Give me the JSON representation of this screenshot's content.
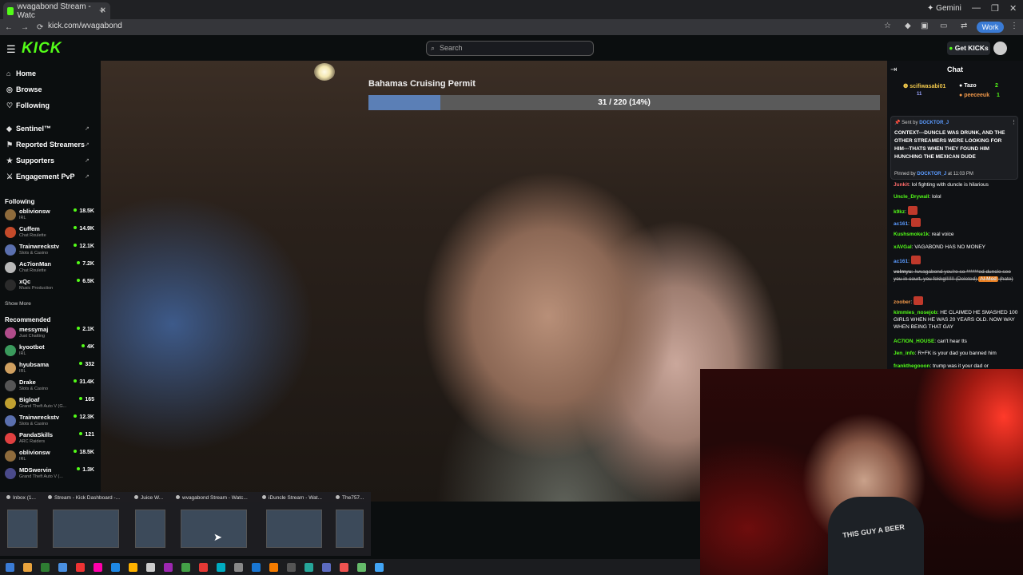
{
  "browser": {
    "tab_title": "wvagabond Stream - Watc",
    "new_tab": "+",
    "gemini": "Gemini",
    "url": "kick.com/wvagabond",
    "profile": "Work",
    "window_controls": [
      "—",
      "❐",
      "✕"
    ]
  },
  "kick": {
    "logo": "KICK",
    "search_placeholder": "Search",
    "get_kicks": "Get KICKs"
  },
  "sidebar": {
    "nav": [
      "Home",
      "Browse",
      "Following"
    ],
    "extras": [
      "Sentinel™",
      "Reported Streamers",
      "Supporters",
      "Engagement PvP"
    ],
    "following_title": "Following",
    "following": [
      {
        "name": "oblivionsw",
        "category": "IRL",
        "viewers": "18.5K",
        "color": "#8e6b3c"
      },
      {
        "name": "Cuffem",
        "category": "Chat Roulette",
        "viewers": "14.9K",
        "color": "#c44a2a"
      },
      {
        "name": "Trainwreckstv",
        "category": "Slots & Casino",
        "viewers": "12.1K",
        "color": "#5a6fae"
      },
      {
        "name": "Ac7ionMan",
        "category": "Chat Roulette",
        "viewers": "7.2K",
        "color": "#b8b8b8"
      },
      {
        "name": "xQc",
        "category": "Music Production",
        "viewers": "6.5K",
        "color": "#2b2b2b"
      }
    ],
    "show_more": "Show More",
    "recommended_title": "Recommended",
    "recommended": [
      {
        "name": "messymaj",
        "category": "Just Chatting",
        "viewers": "2.1K",
        "color": "#b04c8a"
      },
      {
        "name": "kyootbot",
        "category": "IRL",
        "viewers": "4K",
        "color": "#3a9a5c"
      },
      {
        "name": "hyubsama",
        "category": "IRL",
        "viewers": "332",
        "color": "#d0a060"
      },
      {
        "name": "Drake",
        "category": "Slots & Casino",
        "viewers": "31.4K",
        "color": "#555"
      },
      {
        "name": "Bigloaf",
        "category": "Grand Theft Auto V (G...",
        "viewers": "165",
        "color": "#c0a030"
      },
      {
        "name": "Trainwreckstv",
        "category": "Slots & Casino",
        "viewers": "12.3K",
        "color": "#5a6fae"
      },
      {
        "name": "PandaSkills",
        "category": "ARC Raiders",
        "viewers": "121",
        "color": "#e04040"
      },
      {
        "name": "oblivionsw",
        "category": "IRL",
        "viewers": "18.5K",
        "color": "#8e6b3c"
      },
      {
        "name": "MDSwervin",
        "category": "Grand Theft Auto V (...",
        "viewers": "1.3K",
        "color": "#4a4a8a"
      }
    ]
  },
  "stream": {
    "goal_title": "Bahamas Cruising Permit",
    "goal_text": "31 / 220 (14%)",
    "goal_fraction": 0.14
  },
  "chat": {
    "title": "Chat",
    "gifters": [
      {
        "name": "scifiwasabi01",
        "count": "11",
        "color": "#f2c94c"
      },
      {
        "name": "Tazo",
        "count": "2",
        "color": "#ffffff"
      },
      {
        "name": "peeceeuk",
        "count": "1",
        "color": "#f2994a"
      }
    ],
    "pinned": {
      "sent_by": "Sent by",
      "sender": "DOCKTOR_J",
      "text": "CONTEXT---DUNCLE WAS DRUNK, AND THE OTHER STREAMERS WERE LOOKING FOR HIM---THATS WHEN THEY FOUND HIM HUNCHING THE MEXICAN DUDE",
      "pinned_by": "Pinned by",
      "pinner": "DOCKTOR_J",
      "time": "at 11:03 PM"
    },
    "messages": [
      {
        "user": "Junkit",
        "text": "lol fighting with duncle is hilarious",
        "color": "#ff6b6b"
      },
      {
        "user": "Uncle_Drywall",
        "text": "lolol",
        "color": "#53fc18"
      },
      {
        "user": "k9kz",
        "text": "",
        "color": "#53fc18"
      },
      {
        "user": "ac161",
        "text": "",
        "color": "#5b9bff"
      },
      {
        "user": "Kushsmoke1k",
        "text": "real voice",
        "color": "#53fc18"
      },
      {
        "user": "xAVGal",
        "text": "VAGABOND HAS NO MONEY",
        "color": "#53fc18"
      },
      {
        "user": "ac161",
        "text": "",
        "color": "#5b9bff"
      },
      {
        "user": "volmyu",
        "text": "!wvagabond you're so ******ed duncle see you in court, you fekkg!!!!!!",
        "color": "#bbbbbb"
      },
      {
        "user": "zoober",
        "text": "",
        "color": "#f2994a"
      },
      {
        "user": "kimmies_nosejob",
        "text": "HE CLAIMED HE SMASHED 100 GIRLS WHEN HE WAS 20 YEARS OLD. NOW WAY WHEN BEING THAT GAY",
        "color": "#53fc18"
      },
      {
        "user": "AC7ION_HOUSE",
        "text": "can't hear tts",
        "color": "#53fc18"
      },
      {
        "user": "Jen_info",
        "text": "R+FK is your dad you banned him",
        "color": "#53fc18"
      },
      {
        "user": "frankthegooon",
        "text": "trump was it your dad or",
        "color": "#53fc18"
      }
    ],
    "deleted_tag": "(Deleted)",
    "ai_mod": "AI Mod",
    "hate": "(hate)"
  },
  "webcam": {
    "shirt_text": "THIS GUY A BEER"
  },
  "taskbar_previews": [
    {
      "label": "Inbox (1..."
    },
    {
      "label": "Stream - Kick Dashboard -..."
    },
    {
      "label": "Juice W..."
    },
    {
      "label": "wvagabond Stream - Watc..."
    },
    {
      "label": "iDuncle Stream - Wat..."
    },
    {
      "label": "The757..."
    }
  ]
}
